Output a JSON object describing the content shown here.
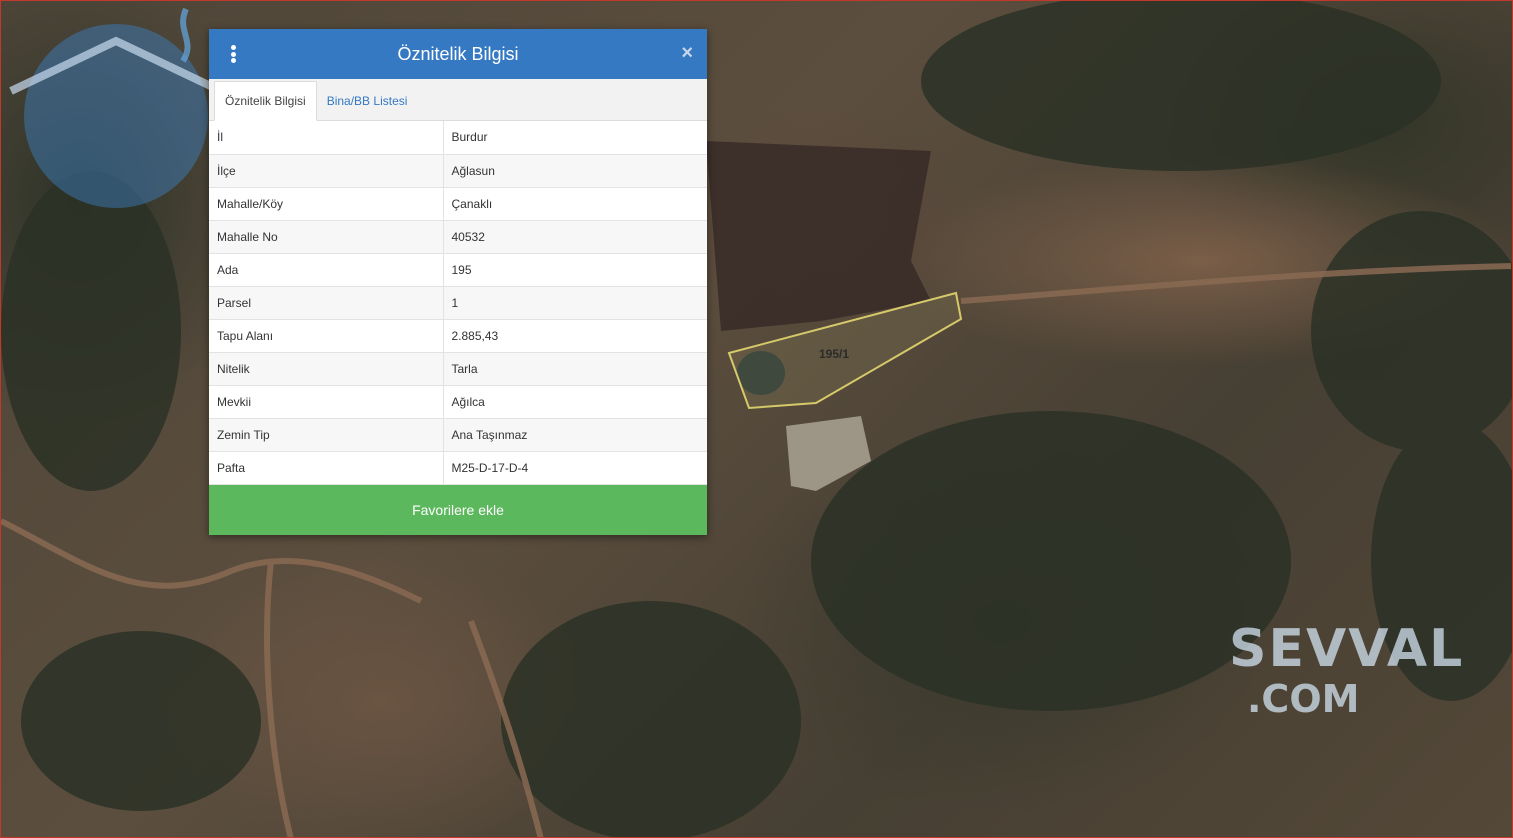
{
  "panel": {
    "title": "Öznitelik Bilgisi",
    "tabs": [
      {
        "label": "Öznitelik Bilgisi",
        "active": true
      },
      {
        "label": "Bina/BB Listesi",
        "active": false
      }
    ],
    "rows": [
      {
        "key": "İl",
        "value": "Burdur"
      },
      {
        "key": "İlçe",
        "value": "Ağlasun"
      },
      {
        "key": "Mahalle/Köy",
        "value": "Çanaklı"
      },
      {
        "key": "Mahalle No",
        "value": "40532"
      },
      {
        "key": "Ada",
        "value": "195"
      },
      {
        "key": "Parsel",
        "value": "1"
      },
      {
        "key": "Tapu Alanı",
        "value": "2.885,43"
      },
      {
        "key": "Nitelik",
        "value": "Tarla"
      },
      {
        "key": "Mevkii",
        "value": "Ağılca"
      },
      {
        "key": "Zemin Tip",
        "value": "Ana Taşınmaz"
      },
      {
        "key": "Pafta",
        "value": "M25-D-17-D-4"
      }
    ],
    "favorite_button": "Favorilere ekle",
    "header_color": "#3579c2",
    "button_color": "#5cb85c"
  },
  "map": {
    "parcel_label": "195/1",
    "watermark": {
      "brand": "SEVVAL",
      "domain": ".COM"
    }
  }
}
